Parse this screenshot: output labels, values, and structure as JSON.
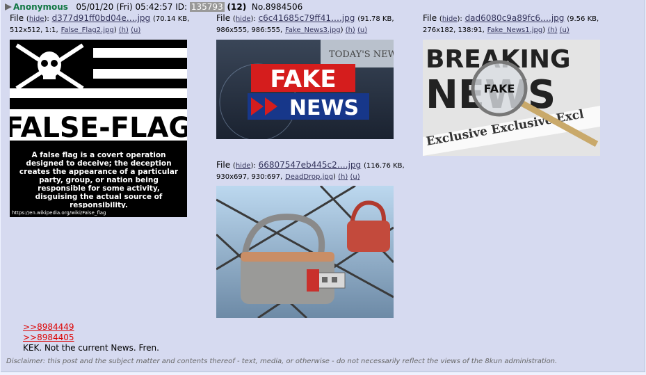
{
  "post": {
    "name": "Anonymous",
    "datetime": "05/01/20 (Fri) 05:42:57",
    "id_label": "ID:",
    "poster_id": "135793",
    "reply_count": "(12)",
    "post_no_label": "No.",
    "post_no": "8984506"
  },
  "files": [
    {
      "file_label": "File",
      "hide_label": "hide",
      "filename": "d377d91ff0bd04e….jpg",
      "size": "(70.14 KB,",
      "dims": "512x512, 1:1,",
      "original": "False_Flag2.jpg",
      "h": "(h)",
      "u": "(u)",
      "image": {
        "skull_icon": "skull-crossed-pistols-icon",
        "banner_text": "FALSE-FLAG",
        "caption": "A false flag is a covert operation designed to deceive; the deception creates the appearance of a particular party, group, or nation being responsible for some activity, disguising the actual source of responsibility.",
        "url": "https://en.wikipedia.org/wiki/False_flag"
      }
    },
    {
      "file_label": "File",
      "hide_label": "hide",
      "filename": "c6c41685c79ff41….jpg",
      "size": "(91.78 KB,",
      "dims": "986x555, 986:555,",
      "original": "Fake_News3.jpg",
      "h": "(h)",
      "u": "(u)",
      "image": {
        "top_word": "FAKE",
        "bottom_word": "NEWS",
        "paper_text": "TODAY'S NEWS"
      }
    },
    {
      "file_label": "File",
      "hide_label": "hide",
      "filename": "dad6080c9a89fc6….jpg",
      "size": "(9.56 KB,",
      "dims": "276x182, 138:91,",
      "original": "Fake_News1.jpg",
      "h": "(h)",
      "u": "(u)",
      "image": {
        "headline1": "BREAKING",
        "headline2": "NEWS",
        "lens_text": "FAKE",
        "strip_text": "Exclusive Exclusive Excl"
      }
    },
    {
      "file_label": "File",
      "hide_label": "hide",
      "filename": "66807547eb445c2….jpg",
      "size": "(116.76 KB,",
      "dims": "930x697, 930:697,",
      "original": "DeadDrop.jpg",
      "h": "(h)",
      "u": "(u)",
      "image": {
        "lock_icon": "padlock-usb-icon"
      }
    }
  ],
  "body": {
    "quote1": ">>8984449",
    "quote2": ">>8984405",
    "text": "KEK. Not the current News. Fren."
  },
  "disclaimer": "Disclaimer: this post and the subject matter and contents thereof - text, media, or otherwise - do not necessarily reflect the views of the 8kun administration.",
  "colors": {
    "post_bg": "#d6daf0",
    "name": "#117743",
    "link": "#34345c",
    "quote": "#dd0000"
  }
}
